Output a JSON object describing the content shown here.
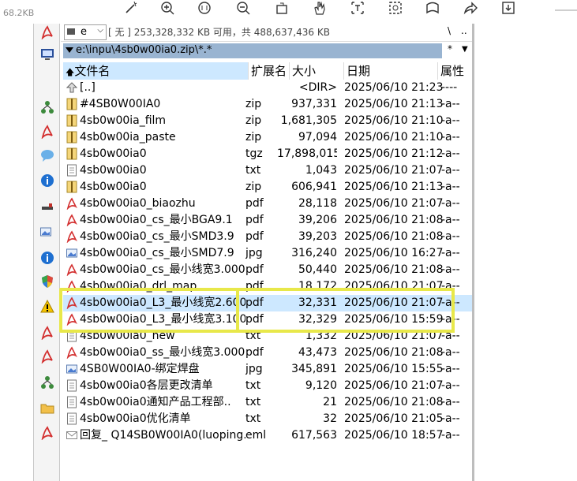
{
  "top": {
    "file_size": "68.2KB",
    "toolbar_icons": [
      "magic-wand-icon",
      "zoom-in-icon",
      "fit-page-icon",
      "zoom-out-icon",
      "rotate-icon",
      "hand-icon",
      "text-select-icon",
      "area-select-icon",
      "reading-mode-icon",
      "share-icon",
      "download-icon"
    ]
  },
  "drive": {
    "letter": "e",
    "info": "[ 无 ]  253,328,332 KB 可用，共 488,637,436 KB",
    "right_ctrl1": "\\",
    "right_ctrl2": ".."
  },
  "path": {
    "text": "e:\\inpu\\4sb0w00ia0.zip\\*.*",
    "star": "*",
    "arrow": "▼"
  },
  "columns": {
    "name": "文件名",
    "ext": "扩展名",
    "size": "大小",
    "date": "日期",
    "attr": "属性"
  },
  "files": [
    {
      "name": "[..]",
      "ext": "",
      "size": "<DIR>",
      "date": "2025/06/10 21:23",
      "attr": "----",
      "icon": "up-icon"
    },
    {
      "name": "#4SB0W00IA0",
      "ext": "zip",
      "size": "937,331",
      "date": "2025/06/10 21:13",
      "attr": "-a--",
      "icon": "zip-icon"
    },
    {
      "name": "4sb0w00ia_film",
      "ext": "zip",
      "size": "1,681,305",
      "date": "2025/06/10 21:10",
      "attr": "-a--",
      "icon": "zip-icon"
    },
    {
      "name": "4sb0w00ia_paste",
      "ext": "zip",
      "size": "97,094",
      "date": "2025/06/10 21:10",
      "attr": "-a--",
      "icon": "zip-icon"
    },
    {
      "name": "4sb0w00ia0",
      "ext": "tgz",
      "size": "17,898,015",
      "date": "2025/06/10 21:12",
      "attr": "-a--",
      "icon": "zip-icon"
    },
    {
      "name": "4sb0w00ia0",
      "ext": "txt",
      "size": "1,043",
      "date": "2025/06/10 21:07",
      "attr": "-a--",
      "icon": "txt-icon"
    },
    {
      "name": "4sb0w00ia0",
      "ext": "zip",
      "size": "606,941",
      "date": "2025/06/10 21:13",
      "attr": "-a--",
      "icon": "zip-icon"
    },
    {
      "name": "4sb0w00ia0_biaozhu",
      "ext": "pdf",
      "size": "28,118",
      "date": "2025/06/10 21:07",
      "attr": "-a--",
      "icon": "pdf-icon"
    },
    {
      "name": "4sb0w00ia0_cs_最小BGA9.1",
      "ext": "pdf",
      "size": "39,206",
      "date": "2025/06/10 21:08",
      "attr": "-a--",
      "icon": "pdf-icon"
    },
    {
      "name": "4sb0w00ia0_cs_最小SMD3.9",
      "ext": "pdf",
      "size": "39,203",
      "date": "2025/06/10 21:08",
      "attr": "-a--",
      "icon": "pdf-icon"
    },
    {
      "name": "4sb0w00ia0_cs_最小SMD7.9",
      "ext": "jpg",
      "size": "316,240",
      "date": "2025/06/10 16:27",
      "attr": "-a--",
      "icon": "image-icon"
    },
    {
      "name": "4sb0w00ia0_cs_最小线宽3.000",
      "ext": "pdf",
      "size": "50,440",
      "date": "2025/06/10 21:08",
      "attr": "-a--",
      "icon": "pdf-icon"
    },
    {
      "name": "4sb0w00ia0_drl_map",
      "ext": "pdf",
      "size": "18,172",
      "date": "2025/06/10 21:07",
      "attr": "-a--",
      "icon": "pdf-icon"
    },
    {
      "name": "4sb0w00ia0_L3_最小线宽2.600",
      "ext": "pdf",
      "size": "32,331",
      "date": "2025/06/10 21:07",
      "attr": "-a--",
      "icon": "pdf-icon",
      "selected": true
    },
    {
      "name": "4sb0w00ia0_L3_最小线宽3.100",
      "ext": "pdf",
      "size": "32,329",
      "date": "2025/06/10 15:59",
      "attr": "-a--",
      "icon": "pdf-icon"
    },
    {
      "name": "4sb0w00ia0_new",
      "ext": "txt",
      "size": "1,332",
      "date": "2025/06/10 21:07",
      "attr": "-a--",
      "icon": "txt-icon"
    },
    {
      "name": "4sb0w00ia0_ss_最小线宽3.000",
      "ext": "pdf",
      "size": "43,473",
      "date": "2025/06/10 21:08",
      "attr": "-a--",
      "icon": "pdf-icon"
    },
    {
      "name": "4SB0W00IA0-绑定焊盘",
      "ext": "jpg",
      "size": "345,891",
      "date": "2025/06/10 15:55",
      "attr": "-a--",
      "icon": "image-icon"
    },
    {
      "name": "4sb0w00ia0各层更改清单",
      "ext": "txt",
      "size": "9,120",
      "date": "2025/06/10 21:07",
      "attr": "-a--",
      "icon": "txt-icon"
    },
    {
      "name": "4sb0w00ia0通知产品工程部..",
      "ext": "txt",
      "size": "21",
      "date": "2025/06/10 21:08",
      "attr": "-a--",
      "icon": "txt-icon"
    },
    {
      "name": "4sb0w00ia0优化清单",
      "ext": "txt",
      "size": "32",
      "date": "2025/06/10 21:05",
      "attr": "-a--",
      "icon": "txt-icon"
    },
    {
      "name": "回复_ Q14SB0W00IA0(luoping..",
      "ext": "eml",
      "size": "617,563",
      "date": "2025/06/10 18:57",
      "attr": "-a--",
      "icon": "mail-icon"
    }
  ],
  "side_icons": [
    "pdf-icon",
    "monitor-icon",
    "network-icon",
    "pdf-icon",
    "chat-icon",
    "info-icon",
    "tool-icon",
    "image-icon",
    "info-icon",
    "shield-icon",
    "warning-icon",
    "pdf-icon",
    "pdf-icon",
    "network-icon",
    "folder-icon",
    "pdf-icon"
  ],
  "colors": {
    "path_bar": "#99b4d1",
    "selection": "#cde8ff",
    "highlight": "#e8e84a",
    "pdf_red": "#d32f2f"
  }
}
